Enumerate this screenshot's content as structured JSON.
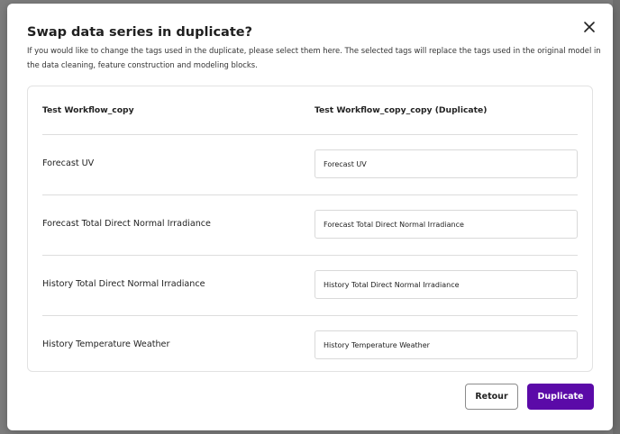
{
  "dialog": {
    "title": "Swap data series in duplicate?",
    "description": "If you would like to change the tags used in the duplicate, please select them here. The selected tags will replace the tags used in the original model in the data cleaning, feature construction and modeling blocks.",
    "close_icon": "close-icon"
  },
  "table": {
    "source_header": "Test Workflow_copy",
    "target_header": "Test Workflow_copy_copy (Duplicate)",
    "rows": [
      {
        "source": "Forecast UV",
        "target": "Forecast UV"
      },
      {
        "source": "Forecast Total Direct Normal Irradiance",
        "target": "Forecast Total Direct Normal Irradiance"
      },
      {
        "source": "History Total Direct Normal Irradiance",
        "target": "History Total Direct Normal Irradiance"
      },
      {
        "source": "History Temperature Weather",
        "target": "History Temperature Weather"
      }
    ]
  },
  "footer": {
    "back_label": "Retour",
    "duplicate_label": "Duplicate"
  },
  "colors": {
    "primary": "#5b0aa8",
    "backdrop": "#7d7d7d"
  }
}
